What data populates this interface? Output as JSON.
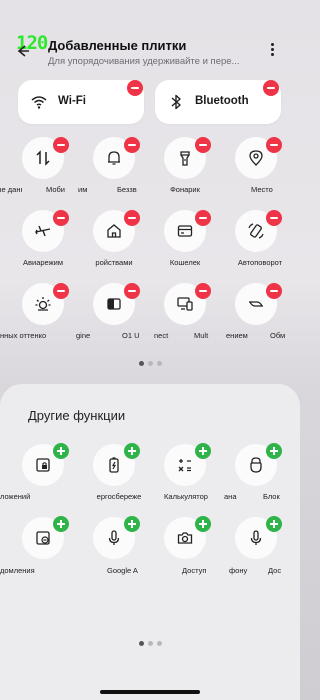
{
  "status": {
    "fps": "120"
  },
  "header": {
    "title": "Добавленные плитки",
    "subtitle": "Для упорядочивания удерживайте и пере..."
  },
  "wide_tiles": [
    {
      "label": "Wi-Fi",
      "icon": "wifi-icon"
    },
    {
      "label": "Bluetooth",
      "icon": "bluetooth-icon"
    }
  ],
  "added_tiles": [
    {
      "label": "ные данные",
      "icon": "mobile-data-icon"
    },
    {
      "label": "Моби",
      "icon": "mobile-data-icon"
    },
    {
      "label": "им",
      "icon": "bell-icon"
    },
    {
      "label": "Беззв",
      "icon": "bell-icon"
    },
    {
      "label": "Фонарик",
      "icon": "flashlight-icon"
    },
    {
      "label": "Место",
      "icon": "location-icon"
    },
    {
      "label": "Авиарежим",
      "icon": "airplane-icon"
    },
    {
      "label": "ройствами",
      "icon": "home-icon"
    },
    {
      "label": "Кошелек",
      "icon": "wallet-icon"
    },
    {
      "label": "Автоповорот",
      "icon": "autorotate-icon"
    },
    {
      "label": "нных оттенко",
      "icon": "eye-comfort-icon"
    },
    {
      "label": "gine",
      "icon": "split-screen-icon"
    },
    {
      "label": "O1 U",
      "icon": "split-screen-icon"
    },
    {
      "label": "nect",
      "icon": "multiscreen-icon"
    },
    {
      "label": "Mult",
      "icon": "multiscreen-icon"
    },
    {
      "label": "ением",
      "icon": "share-icon"
    },
    {
      "label": "Обм",
      "icon": "share-icon"
    }
  ],
  "other": {
    "title": "Другие функции",
    "tiles": [
      {
        "label": "ложений",
        "icon": "app-lock-icon"
      },
      {
        "label": "ергосбереже",
        "icon": "battery-saver-icon"
      },
      {
        "label": "Калькулятор",
        "icon": "calculator-icon"
      },
      {
        "label": "ана",
        "icon": "screen-lock-icon"
      },
      {
        "label": "Блок",
        "icon": "screen-lock-icon"
      },
      {
        "label": "домления",
        "icon": "notifications-icon"
      },
      {
        "label": "Google A",
        "icon": "mic-icon"
      },
      {
        "label": "Доступ",
        "icon": "camera-icon"
      },
      {
        "label": "фону",
        "icon": "mic-icon"
      },
      {
        "label": "Дос",
        "icon": "mic-icon"
      }
    ]
  },
  "colors": {
    "remove": "#ee3446",
    "add": "#2fb44a",
    "fps": "#2ee82e"
  }
}
